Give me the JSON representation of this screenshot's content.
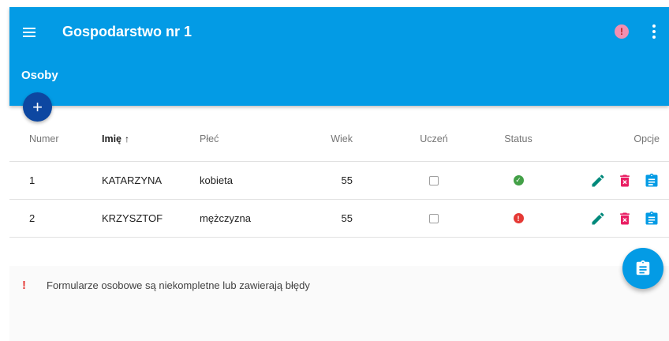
{
  "header": {
    "title": "Gospodarstwo nr 1",
    "alert_glyph": "!",
    "section_title": "Osoby",
    "add_glyph": "+"
  },
  "table": {
    "columns": {
      "numer": "Numer",
      "imie": "Imię",
      "sort_arrow": "↑",
      "plec": "Płeć",
      "wiek": "Wiek",
      "uczen": "Uczeń",
      "status": "Status",
      "opcje": "Opcje"
    },
    "rows": [
      {
        "numer": "1",
        "imie": "KATARZYNA",
        "plec": "kobieta",
        "wiek": "55",
        "uczen": false,
        "status": "ok",
        "status_glyph": "✓"
      },
      {
        "numer": "2",
        "imie": "KRZYSZTOF",
        "plec": "mężczyzna",
        "wiek": "55",
        "uczen": false,
        "status": "error",
        "status_glyph": "!"
      }
    ]
  },
  "footer": {
    "warning_glyph": "!",
    "message": "Formularze osobowe są niekompletne lub zawierają błędy"
  },
  "icons": {
    "menu": "menu-icon",
    "alert": "alert-icon",
    "more": "more-vert-icon",
    "edit": "pencil-icon",
    "delete": "trash-icon",
    "form": "clipboard-icon"
  },
  "colors": {
    "primary": "#039be5",
    "fab_dark": "#0d47a1",
    "edit": "#00897b",
    "delete": "#e91e63",
    "form": "#039be5",
    "status_ok": "#43a047",
    "status_error": "#e53935"
  }
}
